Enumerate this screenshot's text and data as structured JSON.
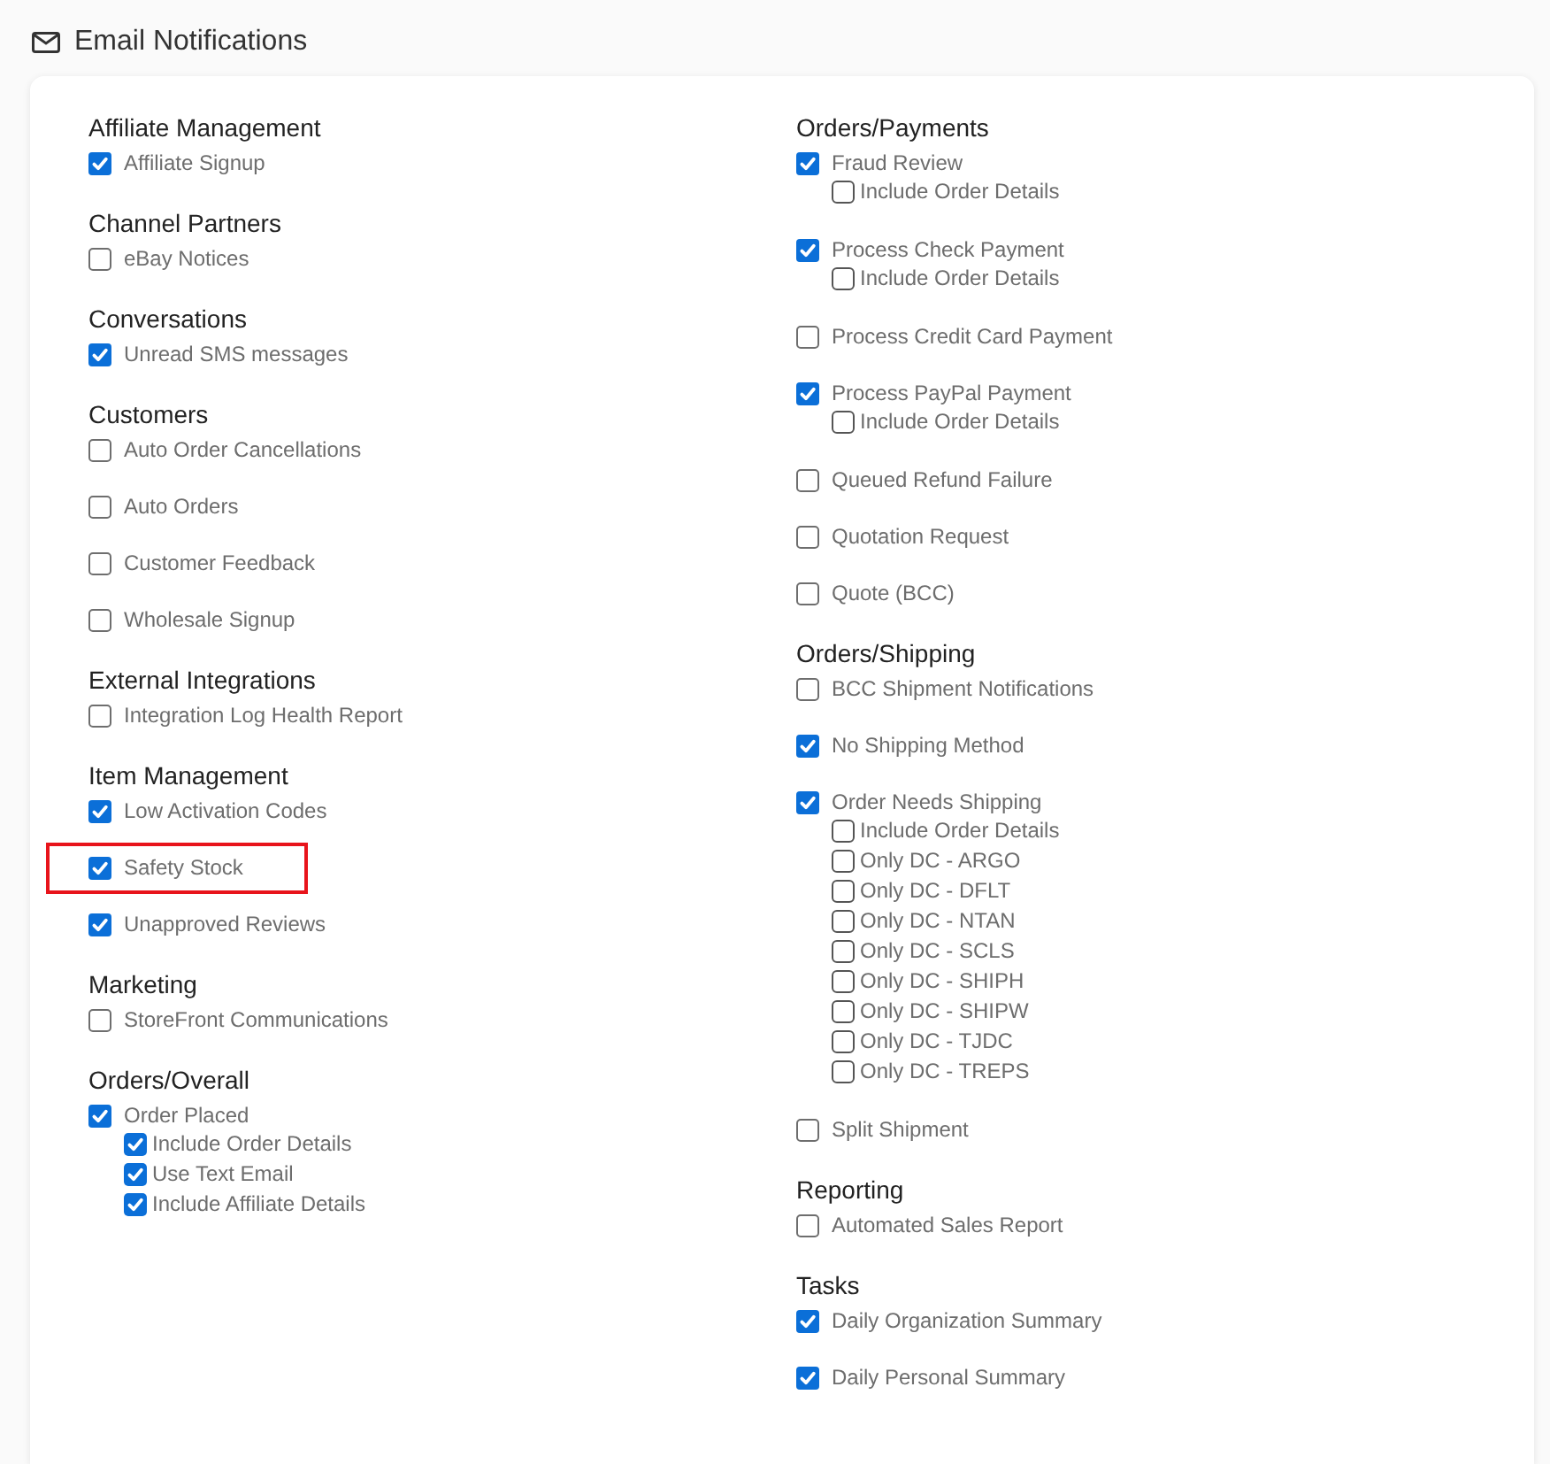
{
  "title": "Email Notifications",
  "columns": [
    {
      "sections": [
        {
          "heading": "Affiliate Management",
          "items": [
            {
              "label": "Affiliate Signup",
              "checked": true,
              "highlighted": false
            }
          ]
        },
        {
          "heading": "Channel Partners",
          "items": [
            {
              "label": "eBay Notices",
              "checked": false,
              "highlighted": false
            }
          ]
        },
        {
          "heading": "Conversations",
          "items": [
            {
              "label": "Unread SMS messages",
              "checked": true,
              "highlighted": false
            }
          ]
        },
        {
          "heading": "Customers",
          "items": [
            {
              "label": "Auto Order Cancellations",
              "checked": false,
              "highlighted": false
            },
            {
              "label": "Auto Orders",
              "checked": false,
              "highlighted": false
            },
            {
              "label": "Customer Feedback",
              "checked": false,
              "highlighted": false
            },
            {
              "label": "Wholesale Signup",
              "checked": false,
              "highlighted": false
            }
          ]
        },
        {
          "heading": "External Integrations",
          "items": [
            {
              "label": "Integration Log Health Report",
              "checked": false,
              "highlighted": false
            }
          ]
        },
        {
          "heading": "Item Management",
          "items": [
            {
              "label": "Low Activation Codes",
              "checked": true,
              "highlighted": false
            },
            {
              "label": "Safety Stock",
              "checked": true,
              "highlighted": true
            },
            {
              "label": "Unapproved Reviews",
              "checked": true,
              "highlighted": false
            }
          ]
        },
        {
          "heading": "Marketing",
          "items": [
            {
              "label": "StoreFront Communications",
              "checked": false,
              "highlighted": false
            }
          ]
        },
        {
          "heading": "Orders/Overall",
          "items": [
            {
              "label": "Order Placed",
              "checked": true,
              "highlighted": false,
              "children": [
                {
                  "label": "Include Order Details",
                  "checked": true
                },
                {
                  "label": "Use Text Email",
                  "checked": true
                },
                {
                  "label": "Include Affiliate Details",
                  "checked": true
                }
              ]
            }
          ]
        }
      ]
    },
    {
      "sections": [
        {
          "heading": "Orders/Payments",
          "items": [
            {
              "label": "Fraud Review",
              "checked": true,
              "highlighted": false,
              "children": [
                {
                  "label": "Include Order Details",
                  "checked": false
                }
              ]
            },
            {
              "label": "Process Check Payment",
              "checked": true,
              "highlighted": false,
              "children": [
                {
                  "label": "Include Order Details",
                  "checked": false
                }
              ]
            },
            {
              "label": "Process Credit Card Payment",
              "checked": false,
              "highlighted": false
            },
            {
              "label": "Process PayPal Payment",
              "checked": true,
              "highlighted": false,
              "children": [
                {
                  "label": "Include Order Details",
                  "checked": false
                }
              ]
            },
            {
              "label": "Queued Refund Failure",
              "checked": false,
              "highlighted": false
            },
            {
              "label": "Quotation Request",
              "checked": false,
              "highlighted": false
            },
            {
              "label": "Quote (BCC)",
              "checked": false,
              "highlighted": false
            }
          ]
        },
        {
          "heading": "Orders/Shipping",
          "items": [
            {
              "label": "BCC Shipment Notifications",
              "checked": false,
              "highlighted": false
            },
            {
              "label": "No Shipping Method",
              "checked": true,
              "highlighted": false
            },
            {
              "label": "Order Needs Shipping",
              "checked": true,
              "highlighted": false,
              "children": [
                {
                  "label": "Include Order Details",
                  "checked": false
                },
                {
                  "label": "Only DC - ARGO",
                  "checked": false
                },
                {
                  "label": "Only DC - DFLT",
                  "checked": false
                },
                {
                  "label": "Only DC - NTAN",
                  "checked": false
                },
                {
                  "label": "Only DC - SCLS",
                  "checked": false
                },
                {
                  "label": "Only DC - SHIPH",
                  "checked": false
                },
                {
                  "label": "Only DC - SHIPW",
                  "checked": false
                },
                {
                  "label": "Only DC - TJDC",
                  "checked": false
                },
                {
                  "label": "Only DC - TREPS",
                  "checked": false
                }
              ]
            },
            {
              "label": "Split Shipment",
              "checked": false,
              "highlighted": false
            }
          ]
        },
        {
          "heading": "Reporting",
          "items": [
            {
              "label": "Automated Sales Report",
              "checked": false,
              "highlighted": false
            }
          ]
        },
        {
          "heading": "Tasks",
          "items": [
            {
              "label": "Daily Organization Summary",
              "checked": true,
              "highlighted": false
            },
            {
              "label": "Daily Personal Summary",
              "checked": true,
              "highlighted": false
            }
          ]
        }
      ]
    }
  ]
}
